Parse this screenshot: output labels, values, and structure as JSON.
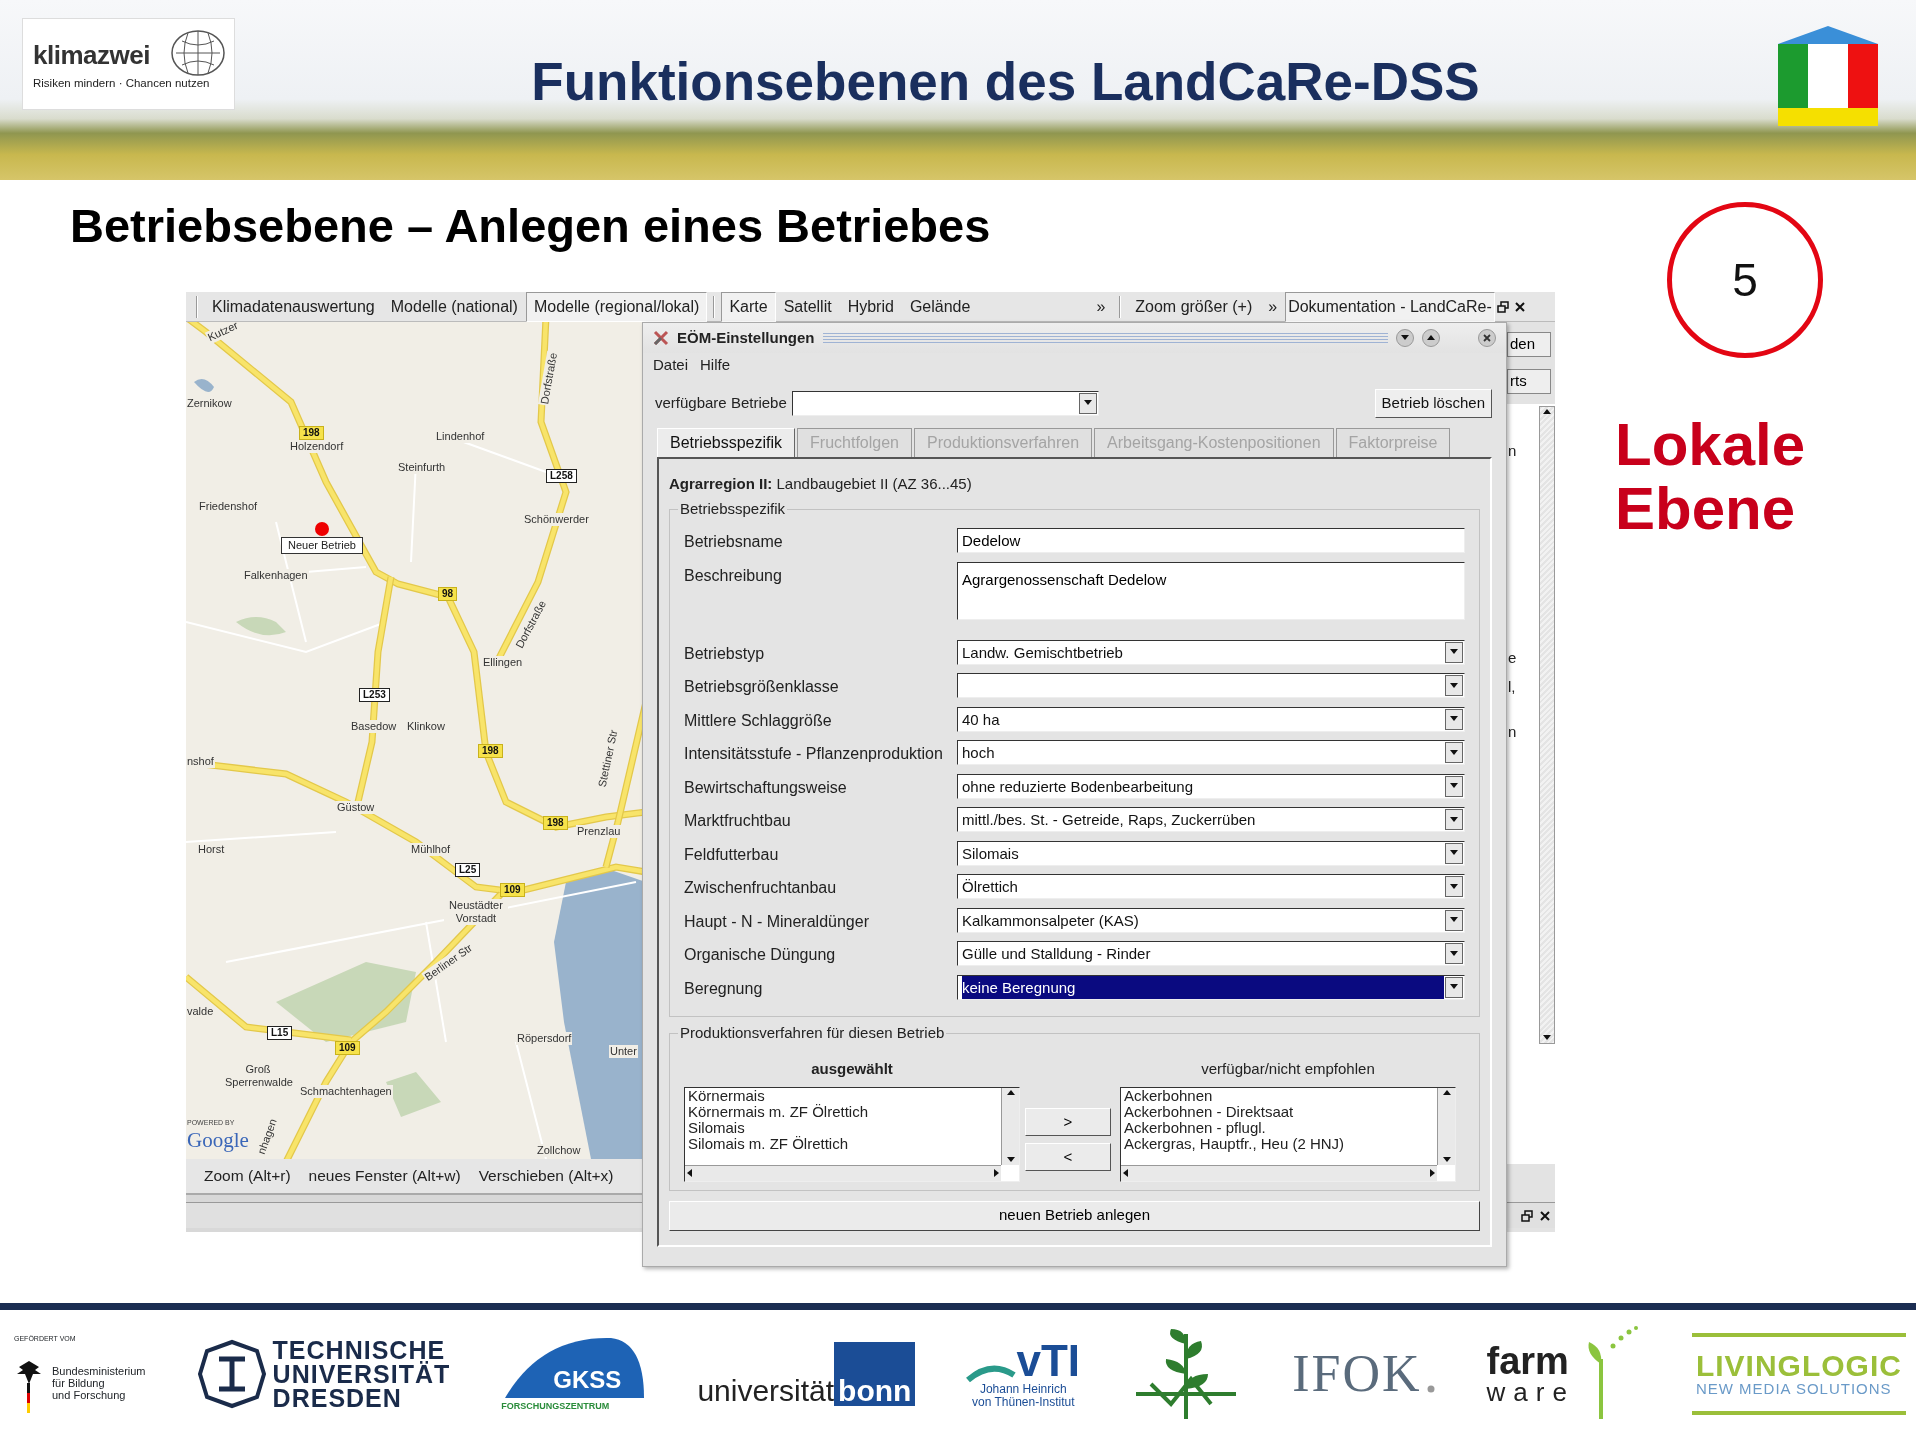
{
  "header": {
    "logo_name": "klimazwei",
    "logo_tagline": "Risiken mindern · Chancen nutzen",
    "title": "Funktionsebenen des LandCaRe-DSS"
  },
  "subtitle": "Betriebsebene – Anlegen eines Betriebes",
  "step": {
    "number": "5",
    "label": "Lokale Ebene"
  },
  "app": {
    "menu_tabs": [
      {
        "label": "Klimadatenauswertung",
        "selected": false
      },
      {
        "label": "Modelle (national)",
        "selected": false
      },
      {
        "label": "Modelle (regional/lokal)",
        "selected": true
      }
    ],
    "map_types": [
      {
        "label": "Karte",
        "selected": true
      },
      {
        "label": "Satellit",
        "selected": false
      },
      {
        "label": "Hybrid",
        "selected": false
      },
      {
        "label": "Gelände",
        "selected": false
      }
    ],
    "more_1": "»",
    "zoom_button": "Zoom größer (+)",
    "more_2": "»",
    "doc_tab": "Dokumentation - LandCaRe-",
    "map": {
      "places": [
        "Kutzer",
        "Zernikow",
        "Holzendorf",
        "Lindenhof",
        "Steinfurth",
        "Friedenshof",
        "Schönwerder",
        "Falkenhagen",
        "Ellingen",
        "Basedow",
        "Klinkow",
        "nshof",
        "Güstow",
        "Prenzlau",
        "Horst",
        "Mühlhof",
        "Neustädter Vorstadt",
        "valde",
        "Röpersdorf",
        "Unter",
        "Groß Sperrenwalde",
        "Schmachtenhagen",
        "Zollchow",
        "Berliner Str",
        "Dorfstraße",
        "Dorfstraße",
        "Stettiner Str",
        "nhagen"
      ],
      "shields": [
        {
          "text": "198",
          "kind": "federal"
        },
        {
          "text": "L258",
          "kind": "state"
        },
        {
          "text": "98",
          "kind": "federal"
        },
        {
          "text": "L253",
          "kind": "state"
        },
        {
          "text": "198",
          "kind": "federal"
        },
        {
          "text": "198",
          "kind": "federal"
        },
        {
          "text": "L25",
          "kind": "state"
        },
        {
          "text": "109",
          "kind": "federal"
        },
        {
          "text": "L15",
          "kind": "state"
        },
        {
          "text": "109",
          "kind": "federal"
        }
      ],
      "marker_label": "Neuer Betrieb",
      "powered_by": "POWERED BY",
      "google": "Google"
    },
    "map_tools": [
      "Zoom (Alt+r)",
      "neues Fenster (Alt+w)",
      "Verschieben (Alt+x)"
    ],
    "side_buttons": [
      "den",
      "rts"
    ],
    "side_fragments": [
      "n",
      "e",
      "l,",
      "n"
    ]
  },
  "dialog": {
    "title": "EÖM-Einstellungen",
    "menu": [
      "Datei",
      "Hilfe"
    ],
    "company_label": "verfügbare Betriebe",
    "delete_button": "Betrieb löschen",
    "tabs": [
      {
        "label": "Betriebsspezifik",
        "selected": true,
        "disabled": false
      },
      {
        "label": "Fruchtfolgen",
        "selected": false,
        "disabled": true
      },
      {
        "label": "Produktionsverfahren",
        "selected": false,
        "disabled": true
      },
      {
        "label": "Arbeitsgang-Kostenpositionen",
        "selected": false,
        "disabled": true
      },
      {
        "label": "Faktorpreise",
        "selected": false,
        "disabled": true
      }
    ],
    "region": "**Agrarregion II:** Landbaugebiet II (AZ 36...45)",
    "group_1": "Betriebsspezifik",
    "fields": [
      {
        "label": "Betriebsname",
        "kind": "text",
        "value": "Dedelow"
      },
      {
        "label": "Beschreibung",
        "kind": "textarea",
        "value": "Agrargenossenschaft Dedelow"
      },
      {
        "label": "Betriebstyp",
        "kind": "combo",
        "value": "Landw. Gemischtbetrieb",
        "highlighted": false
      },
      {
        "label": "Betriebsgrößenklasse",
        "kind": "combo",
        "highlighted": false
      },
      {
        "label": "Mittlere Schlaggröße",
        "kind": "combo",
        "value": "40 ha",
        "highlighted": false
      },
      {
        "label": "Intensitätsstufe - Pflanzenproduktion",
        "kind": "combo",
        "value": "hoch",
        "highlighted": false
      },
      {
        "label": "Bewirtschaftungsweise",
        "kind": "combo",
        "value": "ohne reduzierte Bodenbearbeitung",
        "highlighted": false
      },
      {
        "label": "Marktfruchtbau",
        "kind": "combo",
        "value": "mittl./bes. St. - Getreide, Raps, Zuckerrüben",
        "highlighted": false
      },
      {
        "label": "Feldfutterbau",
        "kind": "combo",
        "value": "Silomais",
        "highlighted": false
      },
      {
        "label": "Zwischenfruchtanbau",
        "kind": "combo",
        "value": "Ölrettich",
        "highlighted": false
      },
      {
        "label": "Haupt - N - Mineraldünger",
        "kind": "combo",
        "value": "Kalkammonsalpeter (KAS)",
        "highlighted": false
      },
      {
        "label": "Organische Düngung",
        "kind": "combo",
        "value": "Gülle und Stalldung - Rinder",
        "highlighted": false
      },
      {
        "label": "Beregnung",
        "kind": "combo",
        "value": "keine Beregnung",
        "highlighted": true
      }
    ],
    "group_2": "Produktionsverfahren für diesen Betrieb",
    "selected_heading": "ausgewählt",
    "selected_items": [
      "Körnermais",
      "Körnermais m. ZF Ölrettich",
      "Silomais",
      "Silomais m. ZF Ölrettich"
    ],
    "add_button": ">",
    "remove_button": "<",
    "available_heading": "verfügbar/nicht empfohlen",
    "available_items": [
      "Ackerbohnen",
      "Ackerbohnen - Direktsaat",
      "Ackerbohnen - pflugl.",
      "Ackergras, Hauptfr., Heu (2 HNJ)"
    ],
    "create_button": "neuen Betrieb anlegen"
  },
  "footer": [
    {
      "kind": "bmbf",
      "lines": [
        "GEFÖRDERT VOM",
        "Bundesministerium",
        "für Bildung",
        "und Forschung"
      ]
    },
    {
      "kind": "tud",
      "lines": [
        "TECHNISCHE",
        "UNIVERSITÄT",
        "DRESDEN"
      ]
    },
    {
      "kind": "gkss",
      "lines": [
        "GKSS",
        "FORSCHUNGSZENTRUM"
      ]
    },
    {
      "kind": "bonn",
      "lines": [
        "universität",
        "bonn"
      ]
    },
    {
      "kind": "vti",
      "lines": [
        "vTI",
        "Johann Heinrich",
        "von Thünen-Institut"
      ]
    },
    {
      "kind": "zalf"
    },
    {
      "kind": "ifok",
      "lines": [
        "IFOK"
      ]
    },
    {
      "kind": "farmware",
      "lines": [
        "farm",
        "ware"
      ]
    },
    {
      "kind": "livinglogic",
      "lines": [
        "LIVINGLOGIC",
        "NEW MEDIA SOLUTIONS"
      ]
    }
  ]
}
